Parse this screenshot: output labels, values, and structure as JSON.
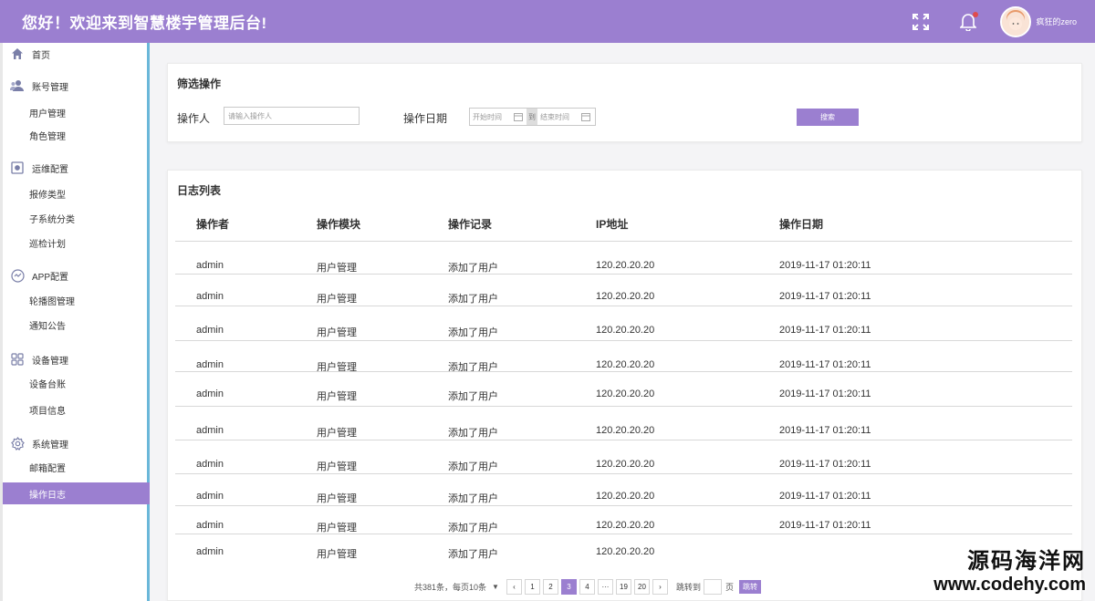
{
  "header": {
    "title": "您好！欢迎来到智慧楼宇管理后台!",
    "username": "疯狂的zero",
    "accent": "#9b7fd0"
  },
  "sidebar": {
    "groups": [
      {
        "label": "首页",
        "icon": "home-icon",
        "items": []
      },
      {
        "label": "账号管理",
        "icon": "users-icon",
        "items": [
          "用户管理",
          "角色管理"
        ]
      },
      {
        "label": "运维配置",
        "icon": "monitor-icon",
        "items": [
          "报修类型",
          "子系统分类",
          "巡检计划"
        ]
      },
      {
        "label": "APP配置",
        "icon": "app-icon",
        "items": [
          "轮播图管理",
          "通知公告"
        ]
      },
      {
        "label": "设备管理",
        "icon": "grid-icon",
        "items": [
          "设备台账",
          "项目信息"
        ]
      },
      {
        "label": "系统管理",
        "icon": "gear-icon",
        "items": [
          "邮箱配置",
          "操作日志"
        ]
      }
    ],
    "active_item": "操作日志"
  },
  "filter": {
    "title": "筛选操作",
    "operator_label": "操作人",
    "operator_placeholder": "请输入操作人",
    "date_label": "操作日期",
    "start_placeholder": "开始时间",
    "date_separator": "到",
    "end_placeholder": "结束时间",
    "search_label": "搜索"
  },
  "log": {
    "title": "日志列表",
    "columns": [
      "操作者",
      "操作模块",
      "操作记录",
      "IP地址",
      "操作日期"
    ],
    "rows": [
      [
        "admin",
        "用户管理",
        "添加了用户",
        "120.20.20.20",
        "2019-11-17 01:20:11"
      ],
      [
        "admin",
        "用户管理",
        "添加了用户",
        "120.20.20.20",
        "2019-11-17 01:20:11"
      ],
      [
        "admin",
        "用户管理",
        "添加了用户",
        "120.20.20.20",
        "2019-11-17 01:20:11"
      ],
      [
        "admin",
        "用户管理",
        "添加了用户",
        "120.20.20.20",
        "2019-11-17 01:20:11"
      ],
      [
        "admin",
        "用户管理",
        "添加了用户",
        "120.20.20.20",
        "2019-11-17 01:20:11"
      ],
      [
        "admin",
        "用户管理",
        "添加了用户",
        "120.20.20.20",
        "2019-11-17 01:20:11"
      ],
      [
        "admin",
        "用户管理",
        "添加了用户",
        "120.20.20.20",
        "2019-11-17 01:20:11"
      ],
      [
        "admin",
        "用户管理",
        "添加了用户",
        "120.20.20.20",
        "2019-11-17 01:20:11"
      ],
      [
        "admin",
        "用户管理",
        "添加了用户",
        "120.20.20.20",
        "2019-11-17 01:20:11"
      ],
      [
        "admin",
        "用户管理",
        "添加了用户",
        "120.20.20.20",
        ""
      ]
    ]
  },
  "pagination": {
    "total_text": "共381条，每页10条",
    "prev": "‹",
    "pages": [
      "1",
      "2",
      "3",
      "4",
      "···",
      "19",
      "20"
    ],
    "active_page": "3",
    "next": "›",
    "jump_label": "跳转到",
    "page_unit": "页",
    "go_label": "跳转"
  },
  "watermark": {
    "line1": "源码海洋网",
    "line2": "www.codehy.com"
  }
}
